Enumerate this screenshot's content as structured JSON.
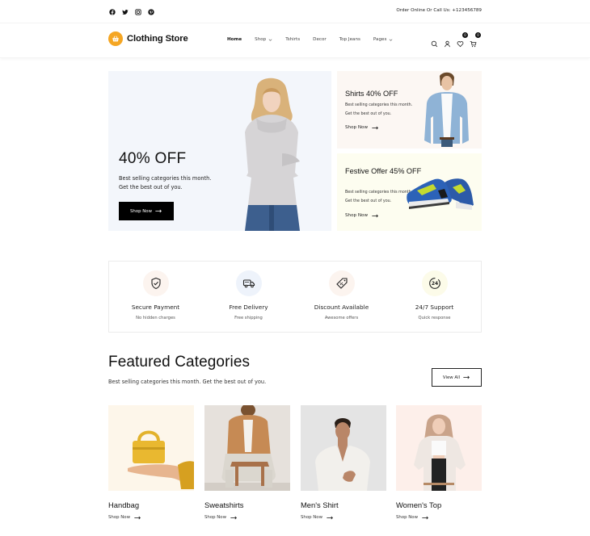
{
  "topbar": {
    "social": [
      "facebook",
      "twitter",
      "instagram",
      "pinterest"
    ],
    "order_text": "Order Online Or Call Us: +123456789"
  },
  "header": {
    "logo_text": "Clothing Store",
    "logo_color": "#f5a623",
    "nav": [
      {
        "label": "Home",
        "active": true
      },
      {
        "label": "Shop",
        "dropdown": true
      },
      {
        "label": "Tshirts"
      },
      {
        "label": "Decor"
      },
      {
        "label": "Top Jeans"
      },
      {
        "label": "Pages",
        "dropdown": true
      }
    ],
    "wishlist_count": "0",
    "cart_count": "0"
  },
  "hero": {
    "main": {
      "title": "40% OFF",
      "text": "Best selling categories this month. Get the best out of you.",
      "button": "Shop Now"
    },
    "promo1": {
      "title": "Shirts 40% OFF",
      "text": "Best selling categories this month. Get the best out of you.",
      "link": "Shop Now"
    },
    "promo2": {
      "title": "Festive Offer 45% OFF",
      "text": "Best selling categories this month. Get the best out of you.",
      "link": "Shop Now"
    }
  },
  "features": [
    {
      "icon": "shield-check",
      "title": "Secure Payment",
      "subtitle": "No hidden charges",
      "bg": "#fcf4ef"
    },
    {
      "icon": "truck",
      "title": "Free Delivery",
      "subtitle": "Free shipping",
      "bg": "#eef3fb"
    },
    {
      "icon": "tag",
      "title": "Discount Available",
      "subtitle": "Awesome offers",
      "bg": "#fcf4ef"
    },
    {
      "icon": "24-support",
      "title": "24/7 Support",
      "subtitle": "Quick response",
      "bg": "#fcfbe9"
    }
  ],
  "featured": {
    "title": "Featured Categories",
    "subtitle": "Best selling categories this month. Get the best out of you.",
    "view_all": "View All",
    "categories": [
      {
        "name": "Handbag",
        "link": "Shop Now",
        "bg": "#fdf6ea"
      },
      {
        "name": "Sweatshirts",
        "link": "Shop Now",
        "bg": "#e9e4df"
      },
      {
        "name": "Men's Shirt",
        "link": "Shop Now",
        "bg": "#e4e4e4"
      },
      {
        "name": "Women's Top",
        "link": "Shop Now",
        "bg": "#fdefea"
      }
    ]
  }
}
